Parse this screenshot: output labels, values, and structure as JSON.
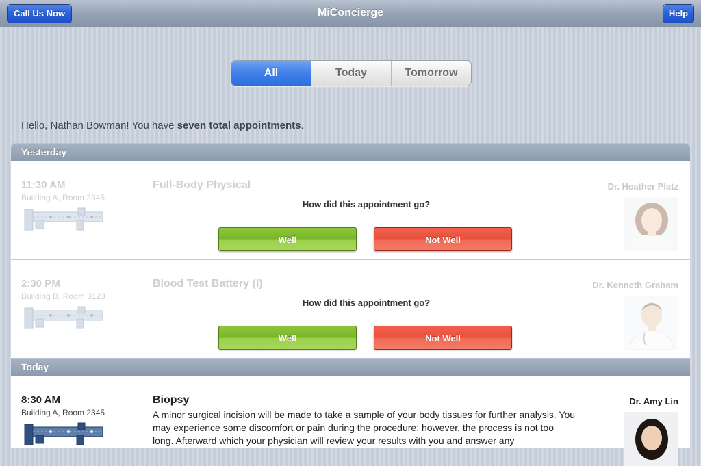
{
  "navbar": {
    "title": "MiConcierge",
    "call_button": "Call Us Now",
    "help_button": "Help"
  },
  "filter": {
    "segments": [
      "All",
      "Today",
      "Tomorrow"
    ],
    "selected": "All"
  },
  "greeting": {
    "prefix": "Hello, Nathan Bowman! You have ",
    "emphasis": "seven total appointments",
    "suffix": "."
  },
  "sections": [
    {
      "header": "Yesterday",
      "appointments": [
        {
          "time": "11:30 AM",
          "location": "Building A, Room 2345",
          "title": "Full-Body Physical",
          "doctor": "Dr. Heather Platz",
          "question": "How did this appointment go?",
          "well_label": "Well",
          "not_well_label": "Not Well"
        },
        {
          "time": "2:30 PM",
          "location": "Building B, Room 3123",
          "title": "Blood Test Battery (I)",
          "doctor": "Dr. Kenneth Graham",
          "question": "How did this appointment go?",
          "well_label": "Well",
          "not_well_label": "Not Well"
        }
      ]
    },
    {
      "header": "Today",
      "appointments": [
        {
          "time": "8:30 AM",
          "location": "Building A, Room 2345",
          "title": "Biopsy",
          "doctor": "Dr. Amy Lin",
          "description": "A minor surgical incision will be made to take a sample of your body tissues for further analysis. You may experience some discomfort or pain during the procedure; however, the process is not too long. Afterward which your physician will review your results with you and answer any"
        }
      ]
    }
  ],
  "colors": {
    "accent_blue": "#2c6fe0",
    "well_green": "#8ec63a",
    "not_well_red": "#e9513d",
    "section_header": "#8d9bae"
  }
}
